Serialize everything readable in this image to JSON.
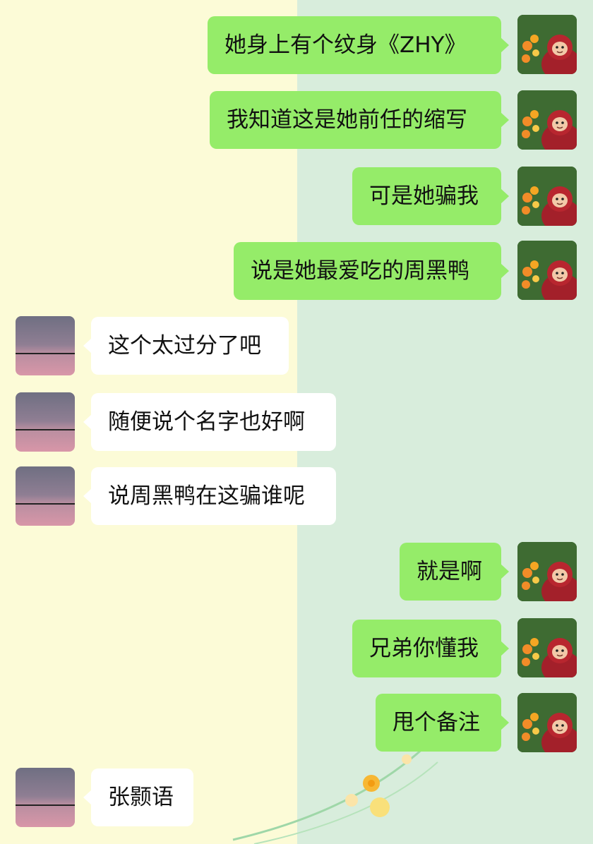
{
  "chat": {
    "messages": [
      {
        "sender": "me",
        "text": "她身上有个纹身《ZHY》"
      },
      {
        "sender": "me",
        "text": "我知道这是她前任的缩写"
      },
      {
        "sender": "me",
        "text": "可是她骗我"
      },
      {
        "sender": "me",
        "text": "说是她最爱吃的周黑鸭"
      },
      {
        "sender": "other",
        "text": "这个太过分了吧"
      },
      {
        "sender": "other",
        "text": "随便说个名字也好啊"
      },
      {
        "sender": "other",
        "text": "说周黑鸭在这骗谁呢"
      },
      {
        "sender": "me",
        "text": "就是啊"
      },
      {
        "sender": "me",
        "text": "兄弟你懂我"
      },
      {
        "sender": "me",
        "text": "甩个备注"
      },
      {
        "sender": "other",
        "text": "张颢语"
      }
    ]
  },
  "colors": {
    "my_bubble": "#95ec69",
    "other_bubble": "#ffffff",
    "left_background": "#fcfbd7",
    "right_background": "#d8eddc"
  },
  "icons": {
    "my_avatar": "teletubby-avatar-icon",
    "other_avatar": "dusk-sky-avatar-icon"
  }
}
